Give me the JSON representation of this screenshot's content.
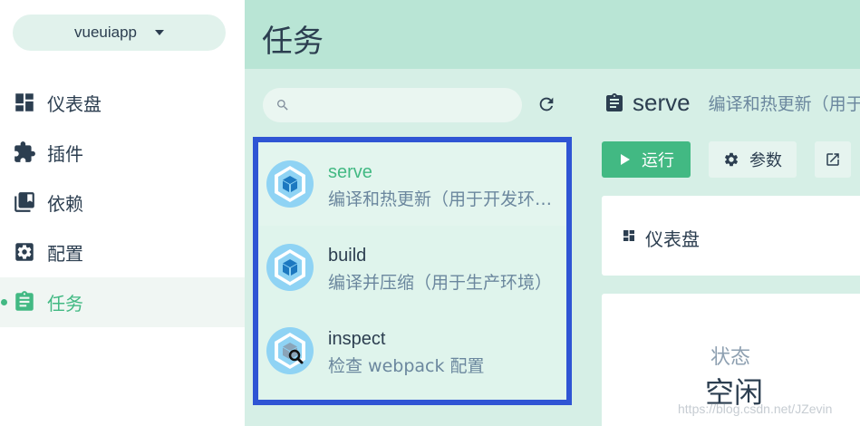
{
  "project_selector": {
    "name": "vueuiapp"
  },
  "sidebar": {
    "items": [
      {
        "label": "仪表盘",
        "icon": "dashboard-icon",
        "active": false
      },
      {
        "label": "插件",
        "icon": "puzzle-icon",
        "active": false
      },
      {
        "label": "依赖",
        "icon": "library-icon",
        "active": false
      },
      {
        "label": "配置",
        "icon": "settings-icon",
        "active": false
      },
      {
        "label": "任务",
        "icon": "clipboard-icon",
        "active": true
      }
    ]
  },
  "header": {
    "title": "任务"
  },
  "search": {
    "placeholder": "",
    "value": ""
  },
  "tasks": [
    {
      "name": "serve",
      "description": "编译和热更新（用于开发环境）",
      "icon": "webpack-icon",
      "selected": true
    },
    {
      "name": "build",
      "description": "编译并压缩（用于生产环境）",
      "icon": "webpack-icon",
      "selected": false
    },
    {
      "name": "inspect",
      "description": "检查 webpack 配置",
      "icon": "webpack-inspect-icon",
      "selected": false
    }
  ],
  "detail": {
    "name": "serve",
    "description": "编译和热更新（用于开发环境）",
    "run_label": "运行",
    "params_label": "参数",
    "dashboard_label": "仪表盘",
    "status_label": "状态",
    "status_value": "空闲"
  },
  "watermark": "https://blog.csdn.net/JZevin",
  "colors": {
    "accent": "#42b983",
    "header_bg": "#b9e5d5",
    "pane_bg": "#d6efe6",
    "highlight_border": "#2f55d4"
  }
}
